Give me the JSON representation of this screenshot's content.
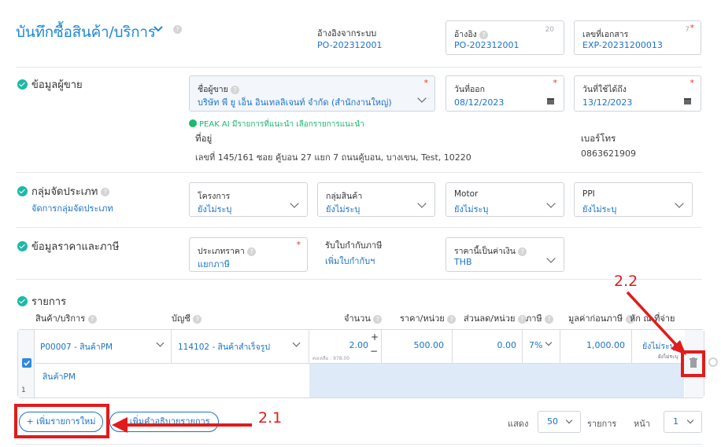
{
  "header": {
    "title": "บันทึกซื้อสินค้า/บริการ",
    "ref_system_label": "อ้างอิงจากระบบ",
    "ref_system_value": "PO-202312001",
    "ref_label": "อ้างอิง",
    "ref_value": "PO-202312001",
    "ref_count": "20",
    "docno_label": "เลขที่เอกสาร",
    "docno_value": "EXP-20231200013",
    "docno_count": "7"
  },
  "vendor": {
    "section_title": "ข้อมูลผู้ขาย",
    "name_label": "ชื่อผู้ขาย",
    "name_value": "บริษัท พี ยู เอ็น อินเทลลิเจนท์ จำกัด (สำนักงานใหญ่)",
    "issue_label": "วันที่ออก",
    "issue_value": "08/12/2023",
    "due_label": "วันที่ใช้ได้ถึง",
    "due_value": "13/12/2023",
    "ai_hint": "PEAK AI มีรายการที่แนะนำ เลือกรายการแนะนำ",
    "address_label": "ที่อยู่",
    "address_value": "เลขที่ 145/161 ซอย คู้บอน 27 แยก 7 ถนนคู้บอน, บางเขน, Test, 10220",
    "phone_label": "เบอร์โทร",
    "phone_value": "0863621909"
  },
  "groups": {
    "section_title": "กลุ่มจัดประเภท",
    "manage_link": "จัดการกลุ่มจัดประเภท",
    "fields": [
      {
        "label": "โครงการ",
        "value": "ยังไม่ระบุ"
      },
      {
        "label": "กลุ่มสินค้า",
        "value": "ยังไม่ระบุ"
      },
      {
        "label": "Motor",
        "value": "ยังไม่ระบุ"
      },
      {
        "label": "PPI",
        "value": "ยังไม่ระบุ"
      }
    ]
  },
  "pricing": {
    "section_title": "ข้อมูลราคาและภาษี",
    "price_type_label": "ประเภทราคา",
    "price_type_value": "แยกภาษี",
    "tax_invoice_label": "รับใบกำกับภาษี",
    "tax_invoice_link": "เพิ่มใบกำกับฯ",
    "currency_label": "ราคานี้เป็นค่าเงิน",
    "currency_value": "THB"
  },
  "items": {
    "section_title": "รายการ",
    "columns": {
      "product": "สินค้า/บริการ",
      "account": "บัญชี",
      "qty": "จำนวน",
      "price": "ราคา/หน่วย",
      "discount": "ส่วนลด/หน่วย",
      "tax": "ภาษี",
      "pretax": "มูลค่าก่อนภาษี",
      "withholding": "หัก ณ ที่จ่าย"
    },
    "row": {
      "product": "P00007 - สินค้าPM",
      "account": "114102 - สินค้าสำเร็จรูป",
      "qty": "2.00",
      "remain": "คงเหลือ : 978.00",
      "price": "500.00",
      "discount": "0.00",
      "tax": "7%",
      "pretax": "1,000.00",
      "withholding": "ยังไม่ระบุ",
      "withholding_sub": "ยังไม่ระบุ",
      "description": "สินค้าPM",
      "index": "1"
    },
    "add_item_button": "+ เพิ่มรายการใหม่",
    "add_desc_button": "+ เพิ่มคำอธิบายรายการ"
  },
  "pagination": {
    "show_label": "แสดง",
    "per_page": "50",
    "items_label": "รายการ",
    "page_label": "หน้า",
    "page": "1"
  },
  "annotations": {
    "callout_1": "2.1",
    "callout_2": "2.2",
    "highlight_color": "#e21b1b"
  }
}
